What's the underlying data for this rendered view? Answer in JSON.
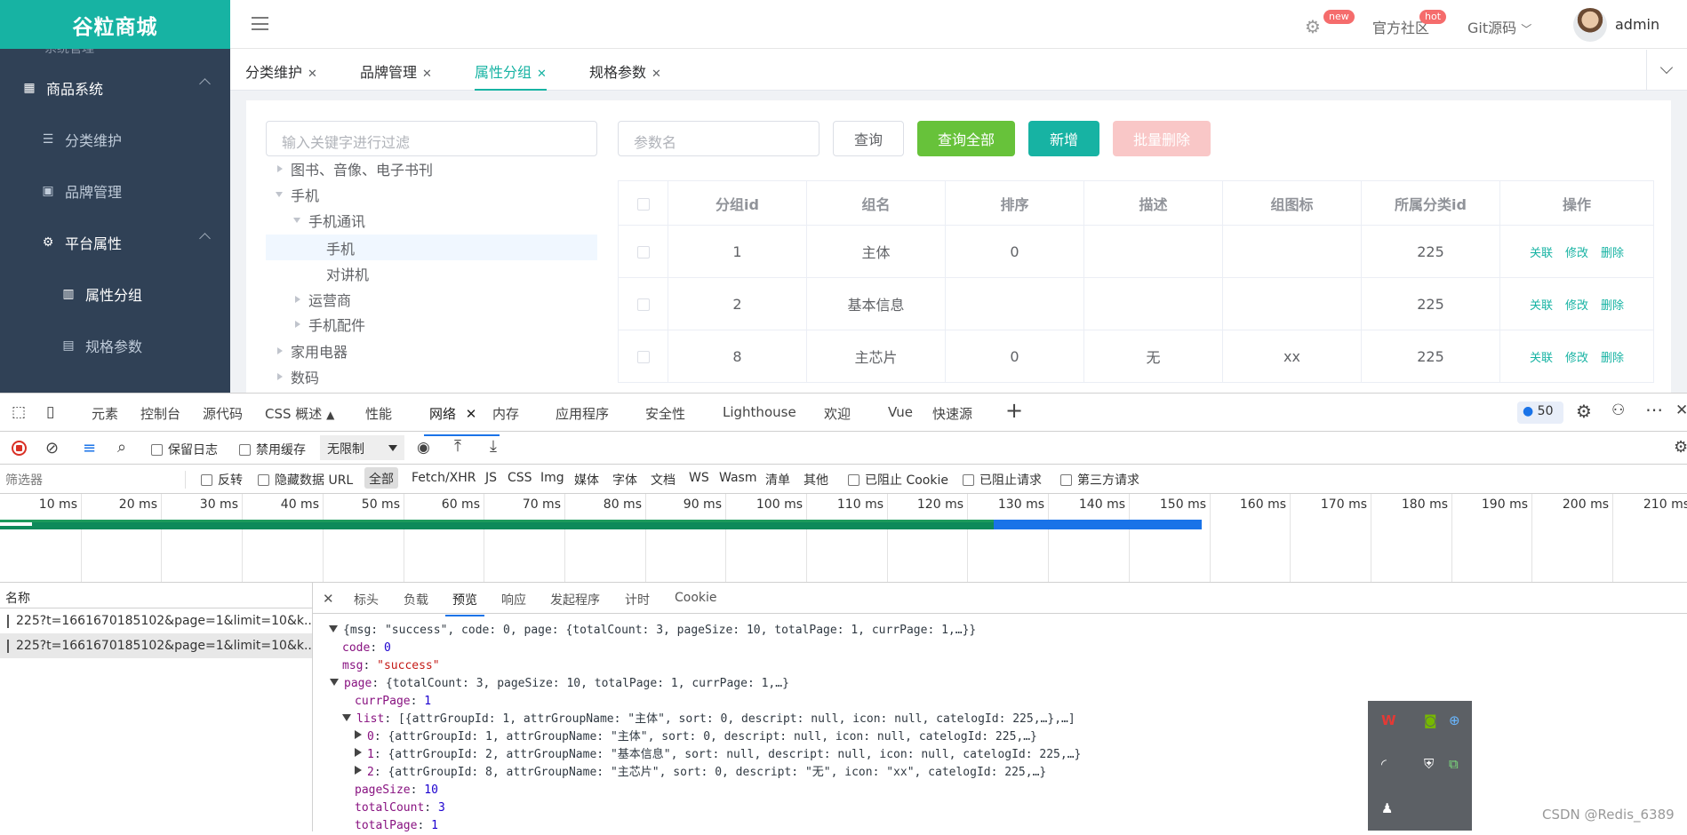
{
  "app": {
    "logo": "谷粒商城",
    "menu_cut": "系统管理",
    "menu": [
      {
        "label": "商品系统",
        "icon": "grid-icon"
      },
      {
        "label": "分类维护",
        "icon": "list-icon"
      },
      {
        "label": "品牌管理",
        "icon": "picture-icon"
      },
      {
        "label": "平台属性",
        "icon": "gear-icon"
      },
      {
        "label": "属性分组",
        "icon": "bar-chart-icon"
      },
      {
        "label": "规格参数",
        "icon": "document-icon"
      }
    ],
    "header": {
      "badge_new": "new",
      "community": "官方社区",
      "badge_hot": "hot",
      "git": "Git源码",
      "user": "admin"
    },
    "tabs": [
      {
        "label": "分类维护"
      },
      {
        "label": "品牌管理"
      },
      {
        "label": "属性分组",
        "active": true
      },
      {
        "label": "规格参数"
      }
    ],
    "filter_placeholder": "输入关键字进行过滤",
    "tree": [
      {
        "label": "图书、音像、电子书刊",
        "level": 0,
        "state": "collapsed"
      },
      {
        "label": "手机",
        "level": 0,
        "state": "expanded"
      },
      {
        "label": "手机通讯",
        "level": 1,
        "state": "expanded"
      },
      {
        "label": "手机",
        "level": 2,
        "state": "leaf",
        "selected": true
      },
      {
        "label": "对讲机",
        "level": 2,
        "state": "leaf"
      },
      {
        "label": "运营商",
        "level": 1,
        "state": "collapsed"
      },
      {
        "label": "手机配件",
        "level": 1,
        "state": "collapsed"
      },
      {
        "label": "家用电器",
        "level": 0,
        "state": "collapsed"
      },
      {
        "label": "数码",
        "level": 0,
        "state": "collapsed"
      }
    ],
    "param_placeholder": "参数名",
    "buttons": {
      "query": "查询",
      "query_all": "查询全部",
      "add": "新增",
      "batch_delete": "批量删除"
    },
    "table": {
      "headers": [
        "分组id",
        "组名",
        "排序",
        "描述",
        "组图标",
        "所属分类id",
        "操作"
      ],
      "rows": [
        {
          "id": "1",
          "name": "主体",
          "sort": "0",
          "desc": "",
          "icon": "",
          "catelog": "225"
        },
        {
          "id": "2",
          "name": "基本信息",
          "sort": "",
          "desc": "",
          "icon": "",
          "catelog": "225"
        },
        {
          "id": "8",
          "name": "主芯片",
          "sort": "0",
          "desc": "无",
          "icon": "xx",
          "catelog": "225"
        }
      ],
      "ops": [
        "关联",
        "修改",
        "删除"
      ]
    }
  },
  "devtools": {
    "tabs": [
      "元素",
      "控制台",
      "源代码",
      "CSS 概述",
      "性能",
      "网络",
      "内存",
      "应用程序",
      "安全性",
      "Lighthouse",
      "欢迎",
      "Vue",
      "快速源"
    ],
    "active_tab": "网络",
    "issues_count": "50",
    "toolbar": {
      "preserve_log": "保留日志",
      "disable_cache": "禁用缓存",
      "throttle": "无限制"
    },
    "filter_bar": {
      "placeholder": "筛选器",
      "invert": "反转",
      "hide_data_url": "隐藏数据 URL",
      "types": [
        "全部",
        "Fetch/XHR",
        "JS",
        "CSS",
        "Img",
        "媒体",
        "字体",
        "文档",
        "WS",
        "Wasm",
        "清单",
        "其他"
      ],
      "blocked_cookies": "已阻止 Cookie",
      "blocked_requests": "已阻止请求",
      "third_party": "第三方请求"
    },
    "timeline_ticks": [
      "10 ms",
      "20 ms",
      "30 ms",
      "40 ms",
      "50 ms",
      "60 ms",
      "70 ms",
      "80 ms",
      "90 ms",
      "100 ms",
      "110 ms",
      "120 ms",
      "130 ms",
      "140 ms",
      "150 ms",
      "160 ms",
      "170 ms",
      "180 ms",
      "190 ms",
      "200 ms",
      "210 ms"
    ],
    "name_header": "名称",
    "requests": [
      "225?t=1661670185102&page=1&limit=10&k...",
      "225?t=1661670185102&page=1&limit=10&k..."
    ],
    "detail_tabs": [
      "标头",
      "负载",
      "预览",
      "响应",
      "发起程序",
      "计时",
      "Cookie"
    ],
    "active_detail_tab": "预览",
    "preview": {
      "root": "{msg: \"success\", code: 0, page: {totalCount: 3, pageSize: 10, totalPage: 1, currPage: 1,…}}",
      "code_k": "code",
      "code_v": "0",
      "msg_k": "msg",
      "msg_v": "\"success\"",
      "page_k": "page",
      "page_v": "{totalCount: 3, pageSize: 10, totalPage: 1, currPage: 1,…}",
      "curr_k": "currPage",
      "curr_v": "1",
      "list_k": "list",
      "list_v": "[{attrGroupId: 1, attrGroupName: \"主体\", sort: 0, descript: null, icon: null, catelogId: 225,…},…]",
      "item0_k": "0",
      "item0_v": "{attrGroupId: 1, attrGroupName: \"主体\", sort: 0, descript: null, icon: null, catelogId: 225,…}",
      "item1_k": "1",
      "item1_v": "{attrGroupId: 2, attrGroupName: \"基本信息\", sort: null, descript: null, icon: null, catelogId: 225,…}",
      "item2_k": "2",
      "item2_v": "{attrGroupId: 8, attrGroupName: \"主芯片\", sort: 0, descript: \"无\", icon: \"xx\", catelogId: 225,…}",
      "psize_k": "pageSize",
      "psize_v": "10",
      "tcount_k": "totalCount",
      "tcount_v": "3",
      "tpage_k": "totalPage",
      "tpage_v": "1"
    }
  },
  "watermark": "CSDN @Redis_6389"
}
